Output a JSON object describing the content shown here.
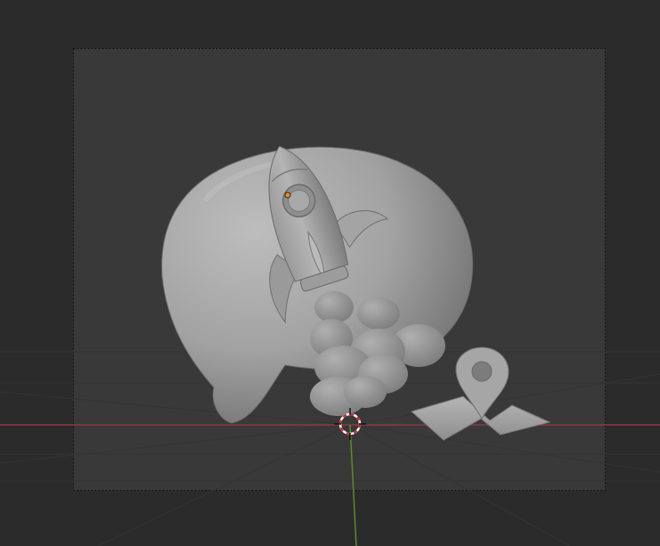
{
  "viewport": {
    "background": "#2b2b2b",
    "camera_frame_fill": "#393939",
    "grid_color": "#353535",
    "x_axis_color": "#8c3a44",
    "y_axis_color": "#5c8a2f",
    "object_color": "#a8a8a8"
  },
  "scene": {
    "objects": [
      "speech-bubble",
      "rocket",
      "smoke-cloud",
      "map-pin"
    ],
    "cursor_icon": "3d-cursor-icon",
    "origin_icon": "object-origin-icon"
  }
}
